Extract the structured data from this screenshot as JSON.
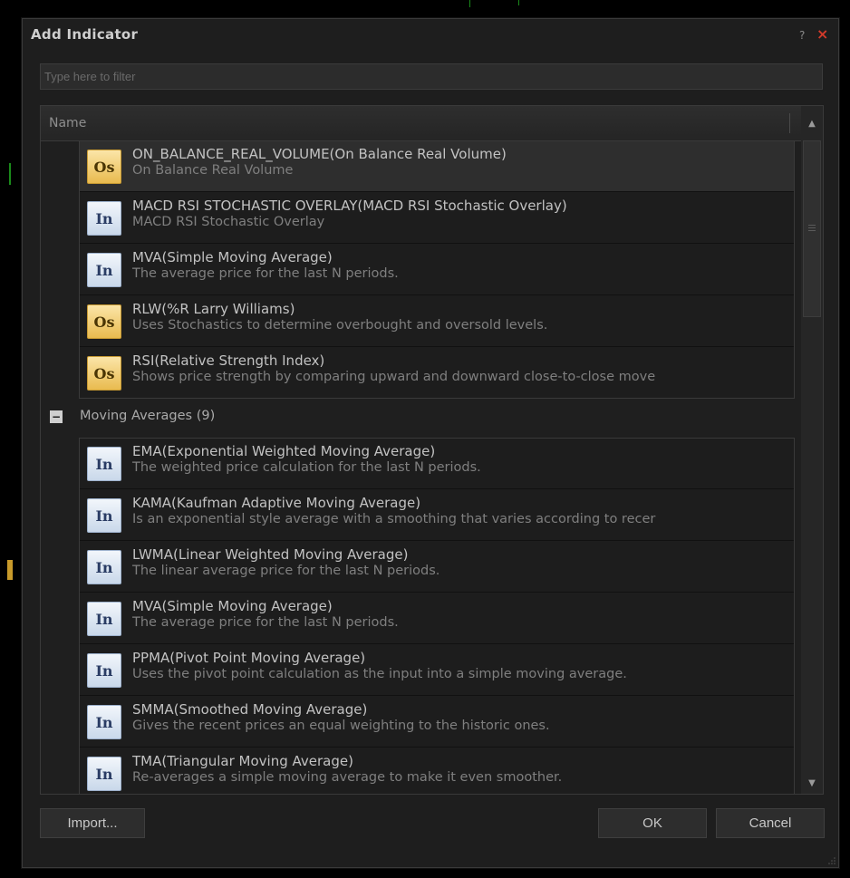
{
  "dialog": {
    "title": "Add Indicator",
    "help_label": "?",
    "close_label": "×"
  },
  "filter": {
    "placeholder": "Type here to filter",
    "value": ""
  },
  "list": {
    "column_header": "Name",
    "top_items": [
      {
        "badge": "Os",
        "kind": "os",
        "name": "ON_BALANCE_REAL_VOLUME(On Balance Real Volume)",
        "desc": "On Balance Real Volume",
        "selected": true
      },
      {
        "badge": "In",
        "kind": "in",
        "name": "MACD RSI STOCHASTIC OVERLAY(MACD RSI Stochastic Overlay)",
        "desc": "MACD RSI Stochastic Overlay"
      },
      {
        "badge": "In",
        "kind": "in",
        "name": "MVA(Simple Moving Average)",
        "desc": "The average price for the last N periods."
      },
      {
        "badge": "Os",
        "kind": "os",
        "name": "RLW(%R Larry Williams)",
        "desc": "Uses Stochastics to determine overbought and oversold levels."
      },
      {
        "badge": "Os",
        "kind": "os",
        "name": "RSI(Relative Strength Index)",
        "desc": "Shows price strength by comparing upward and downward close-to-close move"
      }
    ],
    "group": {
      "toggle": "−",
      "label": "Moving Averages (9)",
      "items": [
        {
          "badge": "In",
          "kind": "in",
          "name": "EMA(Exponential Weighted Moving Average)",
          "desc": "The weighted price calculation for the last N periods."
        },
        {
          "badge": "In",
          "kind": "in",
          "name": "KAMA(Kaufman Adaptive Moving Average)",
          "desc": "Is an exponential style average with a smoothing that varies according to recer"
        },
        {
          "badge": "In",
          "kind": "in",
          "name": "LWMA(Linear Weighted Moving Average)",
          "desc": "The linear average price for the last N periods."
        },
        {
          "badge": "In",
          "kind": "in",
          "name": "MVA(Simple Moving Average)",
          "desc": "The average price for the last N periods."
        },
        {
          "badge": "In",
          "kind": "in",
          "name": "PPMA(Pivot Point Moving Average)",
          "desc": "Uses the pivot point calculation as the input into a simple moving average."
        },
        {
          "badge": "In",
          "kind": "in",
          "name": "SMMA(Smoothed Moving Average)",
          "desc": "Gives the recent prices an equal weighting to the historic ones."
        },
        {
          "badge": "In",
          "kind": "in",
          "name": "TMA(Triangular Moving Average)",
          "desc": "Re-averages a simple moving average to make it even smoother."
        },
        {
          "badge": "",
          "kind": "in",
          "name": "",
          "desc": ""
        }
      ]
    }
  },
  "buttons": {
    "import": "Import...",
    "ok": "OK",
    "cancel": "Cancel"
  },
  "colors": {
    "dialog_bg": "#1e1e1e",
    "close_red": "#d23a2a",
    "os_badge": "#f2cf72",
    "in_badge": "#dbe6f3"
  }
}
